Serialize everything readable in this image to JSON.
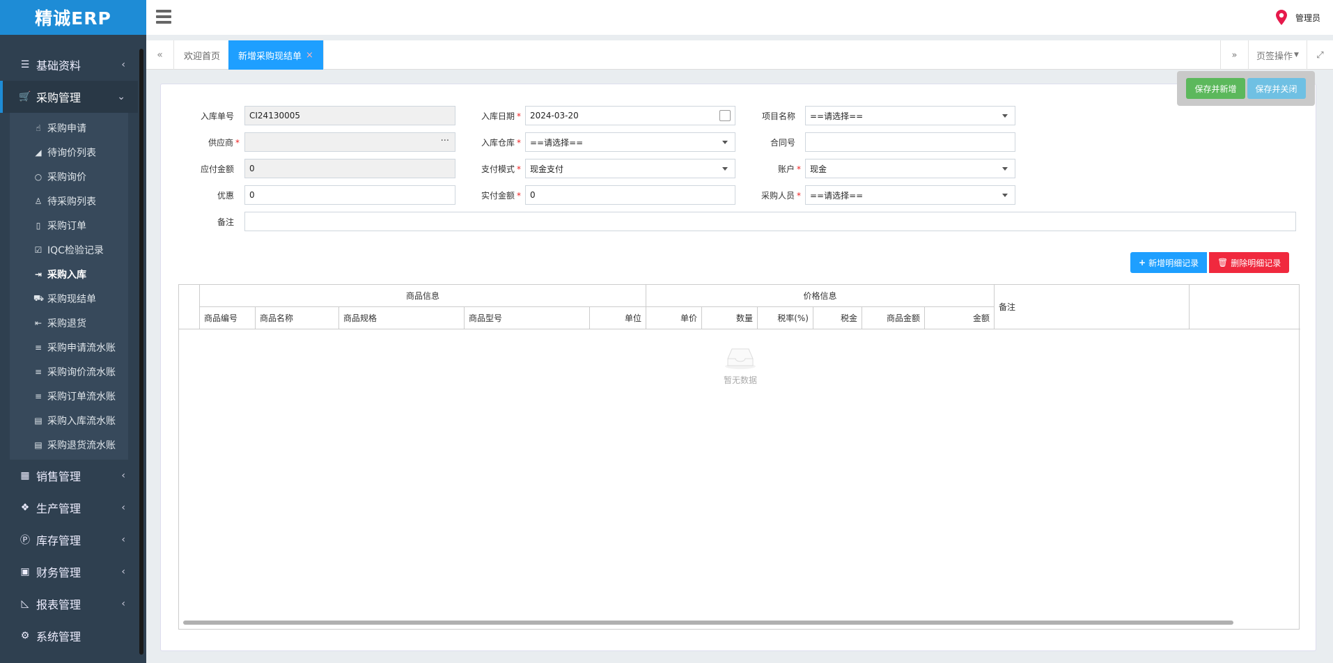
{
  "app": {
    "title": "精诚ERP",
    "user": "管理员"
  },
  "sidebar": {
    "items": [
      {
        "label": "基础资料",
        "icon": "list-icon"
      },
      {
        "label": "采购管理",
        "icon": "cart-icon"
      },
      {
        "label": "销售管理",
        "icon": "building-icon"
      },
      {
        "label": "生产管理",
        "icon": "cubes-icon"
      },
      {
        "label": "库存管理",
        "icon": "parking-icon"
      },
      {
        "label": "财务管理",
        "icon": "money-icon"
      },
      {
        "label": "报表管理",
        "icon": "chart-icon"
      },
      {
        "label": "系统管理",
        "icon": "gear-icon"
      }
    ],
    "sub": [
      {
        "label": "采购申请",
        "icon": "hand-icon"
      },
      {
        "label": "待询价列表",
        "icon": "eraser-icon"
      },
      {
        "label": "采购询价",
        "icon": "circle-icon"
      },
      {
        "label": "待采购列表",
        "icon": "child-icon"
      },
      {
        "label": "采购订单",
        "icon": "file-icon"
      },
      {
        "label": "IQC检验记录",
        "icon": "check-square-icon"
      },
      {
        "label": "采购入库",
        "icon": "sign-in-icon"
      },
      {
        "label": "采购现结单",
        "icon": "cart-icon"
      },
      {
        "label": "采购退货",
        "icon": "sign-out-icon"
      },
      {
        "label": "采购申请流水账",
        "icon": "bars-icon"
      },
      {
        "label": "采购询价流水账",
        "icon": "bars-icon"
      },
      {
        "label": "采购订单流水账",
        "icon": "bars-icon"
      },
      {
        "label": "采购入库流水账",
        "icon": "file-text-icon"
      },
      {
        "label": "采购退货流水账",
        "icon": "file-text-icon"
      }
    ]
  },
  "tabs": {
    "home": "欢迎首页",
    "active": "新增采购现结单",
    "close": "×",
    "ops": "页签操作"
  },
  "actions": {
    "save_new": "保存并新增",
    "save_close": "保存并关闭",
    "add_row": "新增明细记录",
    "del_row": "删除明细记录"
  },
  "form": {
    "in_no": {
      "label": "入库单号",
      "value": "CI24130005"
    },
    "in_date": {
      "label": "入库日期",
      "value": "2024-03-20"
    },
    "project": {
      "label": "项目名称",
      "value": "==请选择=="
    },
    "supplier": {
      "label": "供应商",
      "value": ""
    },
    "warehouse": {
      "label": "入库仓库",
      "value": "==请选择=="
    },
    "contract": {
      "label": "合同号",
      "value": ""
    },
    "payable": {
      "label": "应付金额",
      "value": "0"
    },
    "pay_mode": {
      "label": "支付模式",
      "value": "现金支付"
    },
    "account": {
      "label": "账户",
      "value": "现金"
    },
    "discount": {
      "label": "优惠",
      "value": "0"
    },
    "paid": {
      "label": "实付金额",
      "value": "0"
    },
    "buyer": {
      "label": "采购人员",
      "value": "==请选择=="
    },
    "remark": {
      "label": "备注",
      "value": ""
    },
    "required_mark": "*"
  },
  "grid": {
    "group_goods": "商品信息",
    "group_price": "价格信息",
    "remark": "备注",
    "columns": [
      "商品编号",
      "商品名称",
      "商品规格",
      "商品型号",
      "单位",
      "单价",
      "数量",
      "税率(%)",
      "税金",
      "商品金额",
      "金额"
    ],
    "empty": "暂无数据"
  }
}
